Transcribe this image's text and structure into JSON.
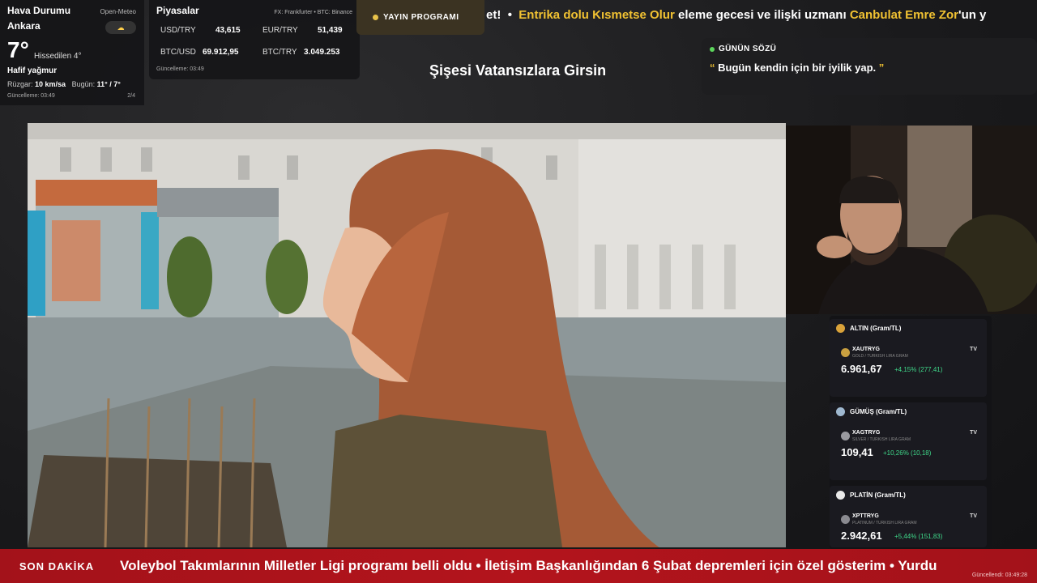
{
  "weather": {
    "title": "Hava Durumu",
    "source": "Open-Meteo",
    "city": "Ankara",
    "condition_icon": "partly-cloudy-icon",
    "temperature": "7°",
    "feels_like": "Hissedilen 4°",
    "description": "Hafif yağmur",
    "wind_label": "Rüzgar:",
    "wind_value": "10 km/sa",
    "today_label": "Bugün:",
    "today_value": "11° / 7°",
    "updated": "Güncelleme: 03:49",
    "page": "2/4"
  },
  "markets": {
    "title": "Piyasalar",
    "source": "FX: Frankfurter • BTC: Binance",
    "rows": [
      {
        "label": "USD/TRY",
        "value": "43,615"
      },
      {
        "label": "EUR/TRY",
        "value": "51,439"
      },
      {
        "label": "BTC/USD",
        "value": "69.912,95"
      },
      {
        "label": "BTC/TRY",
        "value": "3.049.253"
      }
    ],
    "updated": "Güncelleme: 03:49"
  },
  "program": {
    "label": "YAYIN PROGRAMI"
  },
  "top_ticker": {
    "prefix": "et!",
    "separator": "•",
    "show": "Entrika dolu Kısmetse Olur",
    "middle": "eleme gecesi ve ilişki uzmanı",
    "guest": "Canbulat Emre Zor",
    "suffix": "'un y"
  },
  "show_title": "Şişesi Vatansızlara Girsin",
  "quote": {
    "label": "GÜNÜN SÖZÜ",
    "open": "“",
    "text": "Bugün kendin için bir iyilik yap.",
    "close": "”"
  },
  "commodities": [
    {
      "name": "ALTIN (Gram/TL)",
      "symbol": "XAUTRYG",
      "sub": "GOLD / TURKISH LIRA GRAM",
      "price": "6.961,67",
      "change": "+4,15% (277,41)",
      "medal_color": "#d9a23a",
      "coin_color": "#c9a040"
    },
    {
      "name": "GÜMÜŞ (Gram/TL)",
      "symbol": "XAGTRYG",
      "sub": "SILVER / TURKISH LIRA GRAM",
      "price": "109,41",
      "change": "+10,26% (10,18)",
      "medal_color": "#9fb8d0",
      "coin_color": "#9a9aa0"
    },
    {
      "name": "PLATİN (Gram/TL)",
      "symbol": "XPTTRYG",
      "sub": "PLATINUM / TURKISH LIRA GRAM",
      "price": "2.942,61",
      "change": "+5,44% (151,83)",
      "medal_color": "#e8e8e8",
      "coin_color": "#8a8a90"
    }
  ],
  "tv_label": "TV",
  "breaking": {
    "label": "SON DAKİKA",
    "news": "Voleybol Takımlarının Milletler Ligi programı belli oldu  •  İletişim Başkanlığından 6 Şubat depremleri için özel gösterim  •  Yurdu",
    "updated": "Güncellendi: 03:49:28"
  },
  "colors": {
    "accent_yellow": "#f1c232",
    "breaking_red": "#b3141c",
    "positive_green": "#3fd98a"
  }
}
